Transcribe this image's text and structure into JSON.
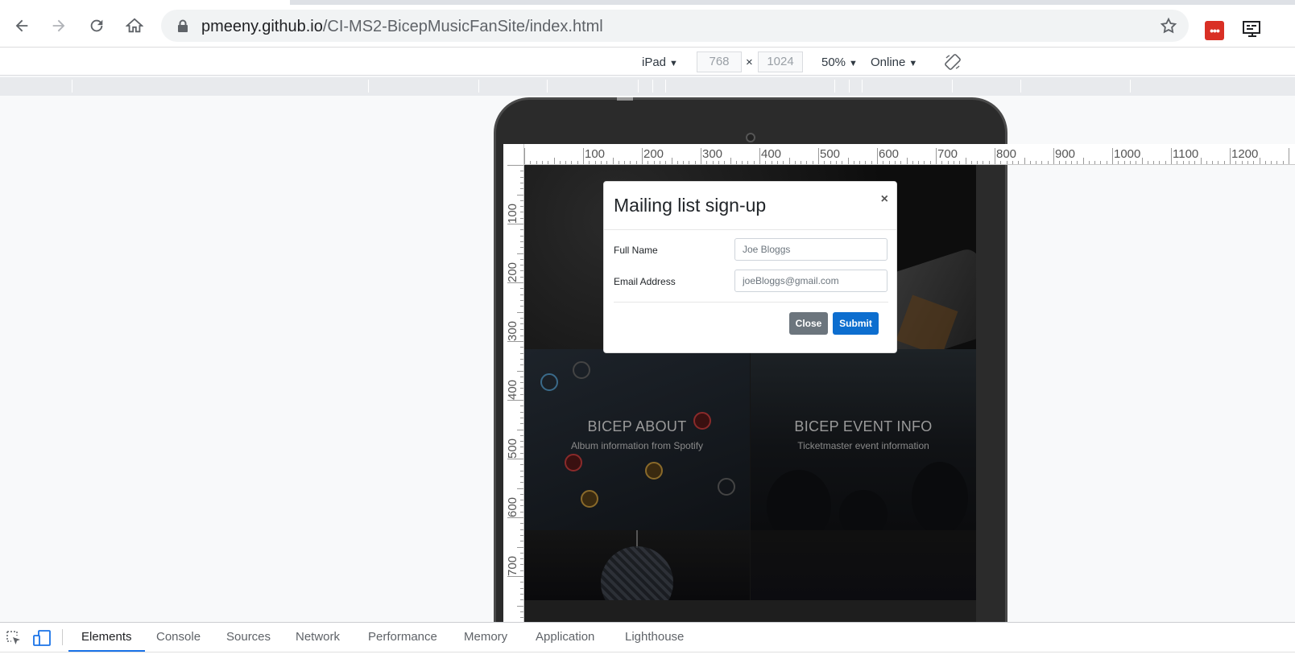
{
  "browser": {
    "url_host": "pmeeny.github.io",
    "url_path": "/CI-MS2-BicepMusicFanSite/index.html",
    "icons": [
      "back-icon",
      "forward-icon",
      "reload-icon",
      "home-icon",
      "lock-icon",
      "bookmark-star-icon",
      "extension-icon",
      "cast-icon"
    ],
    "extension_badge": "•••"
  },
  "device_toolbar": {
    "device": "iPad",
    "width": "768",
    "height": "1024",
    "times": "×",
    "zoom": "50%",
    "throttle": "Online",
    "caret": "▼"
  },
  "rulers": {
    "horizontal": [
      "100",
      "200",
      "300",
      "400",
      "500",
      "600",
      "700",
      "800",
      "900",
      "1000",
      "1100",
      "1200"
    ],
    "vertical": [
      "100",
      "200",
      "300",
      "400",
      "500",
      "600",
      "700"
    ]
  },
  "site": {
    "tiles": [
      {
        "title": "BICEP ABOUT",
        "subtitle": "Album information from Spotify"
      },
      {
        "title": "BICEP EVENT INFO",
        "subtitle": "Ticketmaster event information"
      }
    ]
  },
  "modal": {
    "title": "Mailing list sign-up",
    "close_symbol": "×",
    "fields": [
      {
        "label": "Full Name",
        "placeholder": "Joe Bloggs"
      },
      {
        "label": "Email Address",
        "placeholder": "joeBloggs@gmail.com"
      }
    ],
    "close_button": "Close",
    "submit_button": "Submit"
  },
  "devtools": {
    "tabs": [
      "Elements",
      "Console",
      "Sources",
      "Network",
      "Performance",
      "Memory",
      "Application",
      "Lighthouse"
    ],
    "active_tab": "Elements",
    "accent": "#1a73e8"
  }
}
